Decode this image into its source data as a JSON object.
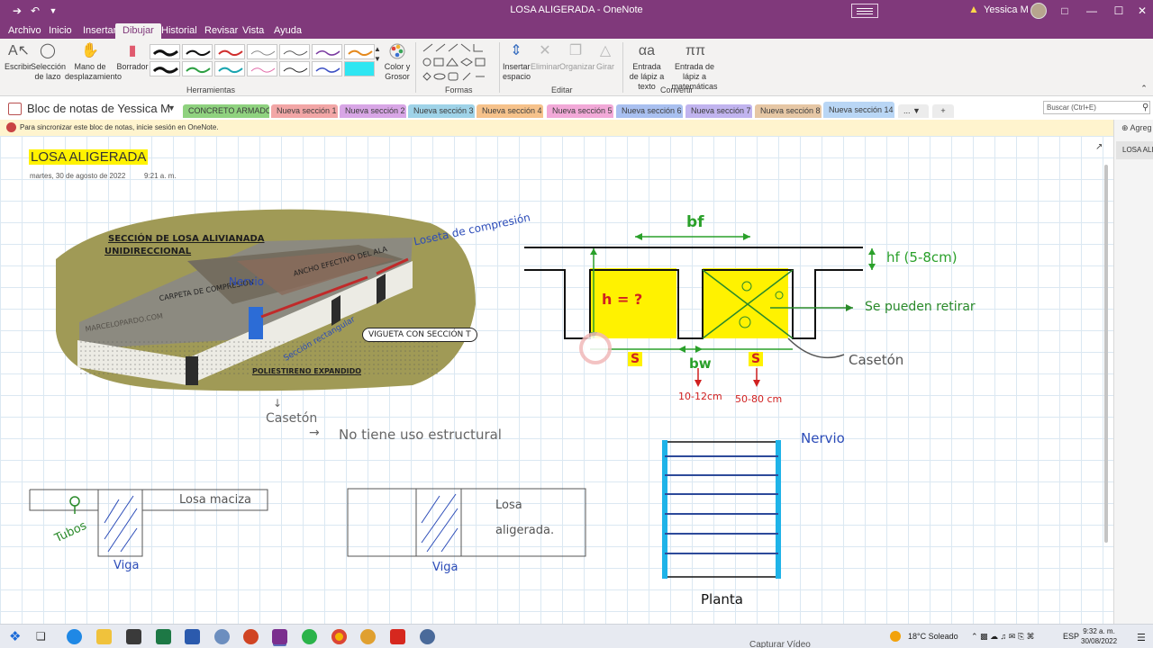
{
  "window": {
    "title": "LOSA ALIGERADA - OneNote",
    "user": "Yessica M M"
  },
  "menu": {
    "tabs": [
      "Archivo",
      "Inicio",
      "Insertar",
      "Dibujar",
      "Historial",
      "Revisar",
      "Vista",
      "Ayuda"
    ],
    "active": "Dibujar"
  },
  "ribbon": {
    "escribir": "Escribir",
    "seleccion": "Selección de lazo",
    "mano": "Mano de desplazamiento",
    "borrador": "Borrador",
    "color_grosor": "Color y Grosor",
    "group_herramientas": "Herramientas",
    "group_formas": "Formas",
    "insertar_espacio": "Insertar espacio",
    "eliminar": "Eliminar",
    "organizar": "Organizar",
    "girar": "Girar",
    "group_editar": "Editar",
    "lapiz_texto": "Entrada de lápiz a texto",
    "lapiz_mate": "Entrada de lápiz a matemáticas",
    "group_convertir": "Convertir"
  },
  "notebook": {
    "name": "Bloc de notas de Yessica M",
    "search_placeholder": "Buscar (Ctrl+E)",
    "sections": [
      {
        "label": "CONCRETO ARMADO",
        "color": "#8fd27f"
      },
      {
        "label": "Nueva sección 1",
        "color": "#f2a6a6"
      },
      {
        "label": "Nueva sección 2",
        "color": "#d8a6e6"
      },
      {
        "label": "Nueva sección 3",
        "color": "#9fd3e8"
      },
      {
        "label": "Nueva sección 4",
        "color": "#f6c28b"
      },
      {
        "label": "Nueva sección 5",
        "color": "#f2a9d8"
      },
      {
        "label": "Nueva sección 6",
        "color": "#a9c0f0"
      },
      {
        "label": "Nueva sección 7",
        "color": "#c1b4ef"
      },
      {
        "label": "Nueva sección 8",
        "color": "#e6c7a5"
      },
      {
        "label": "Nueva sección 14",
        "color": "#b9d6f5"
      }
    ],
    "more_label": "..."
  },
  "sync_message": "Para sincronizar este bloc de notas, inicie sesión en OneNote.",
  "pages": {
    "add_label": "Agreg",
    "current": "LOSA ALI"
  },
  "page": {
    "title": "LOSA ALIGERADA",
    "date": "martes, 30 de agosto de 2022",
    "time": "9:21 a. m."
  },
  "sketch": {
    "heading_1": "SECCIÓN DE LOSA ALIVIANADA",
    "heading_2": "UNIDIRECCIONAL",
    "capa": "CARPETA DE COMPRESIÓN",
    "ancho": "ANCHO EFECTIVO DEL ALA",
    "watermark": "MARCELOPARDO.COM",
    "nervio": "Nervio",
    "loseta": "Loseta de compresión",
    "vigueta": "VIGUETA CON SECCIÓN T",
    "seccion_rect": "Sección rectangular",
    "poliestireno": "POLIESTIRENO EXPANDIDO"
  },
  "notes": {
    "casetonnote": "Casetón",
    "no_uso": "No tiene uso estructural",
    "bf": "bf",
    "hf": "hf (5-8cm)",
    "h_q": "h = ?",
    "se_pueden": "Se pueden retirar",
    "caseton_label": "Casetón",
    "s1": "S",
    "bw": "bw",
    "s2": "S",
    "bw_range": "10-12cm",
    "s_range": "50-80 cm",
    "nervio": "Nervio",
    "planta": "Planta",
    "losa_maciza": "Losa maciza",
    "tubos": "Tubos",
    "viga_1": "Viga",
    "losa_aligerada": "Losa aligerada.",
    "viga_2": "Viga"
  },
  "taskbar": {
    "weather": "18°C Soleado",
    "lang": "ESP",
    "time": "9:32 a. m.",
    "date": "30/08/2022",
    "capture": "Capturar Vídeo"
  }
}
